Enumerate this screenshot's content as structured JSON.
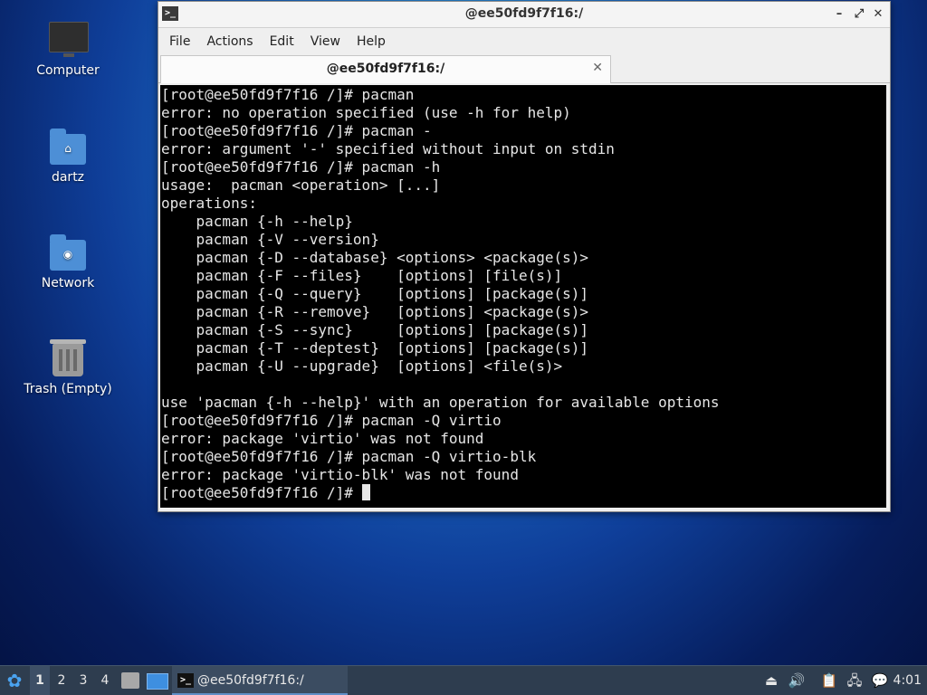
{
  "desktop": {
    "icons": [
      {
        "label": "Computer"
      },
      {
        "label": "dartz"
      },
      {
        "label": "Network"
      },
      {
        "label": "Trash (Empty)"
      }
    ]
  },
  "window": {
    "title": "@ee50fd9f7f16:/",
    "controls": {
      "minimize": "–",
      "maximize": "⤢",
      "close": "✕"
    },
    "menu": [
      "File",
      "Actions",
      "Edit",
      "View",
      "Help"
    ],
    "tab": {
      "label": "@ee50fd9f7f16:/",
      "close": "✕"
    },
    "terminal_lines": [
      "[root@ee50fd9f7f16 /]# pacman",
      "error: no operation specified (use -h for help)",
      "[root@ee50fd9f7f16 /]# pacman -",
      "error: argument '-' specified without input on stdin",
      "[root@ee50fd9f7f16 /]# pacman -h",
      "usage:  pacman <operation> [...]",
      "operations:",
      "    pacman {-h --help}",
      "    pacman {-V --version}",
      "    pacman {-D --database} <options> <package(s)>",
      "    pacman {-F --files}    [options] [file(s)]",
      "    pacman {-Q --query}    [options] [package(s)]",
      "    pacman {-R --remove}   [options] <package(s)>",
      "    pacman {-S --sync}     [options] [package(s)]",
      "    pacman {-T --deptest}  [options] [package(s)]",
      "    pacman {-U --upgrade}  [options] <file(s)>",
      "",
      "use 'pacman {-h --help}' with an operation for available options",
      "[root@ee50fd9f7f16 /]# pacman -Q virtio",
      "error: package 'virtio' was not found",
      "[root@ee50fd9f7f16 /]# pacman -Q virtio-blk",
      "error: package 'virtio-blk' was not found"
    ],
    "prompt": "[root@ee50fd9f7f16 /]# "
  },
  "taskbar": {
    "workspaces": [
      "1",
      "2",
      "3",
      "4"
    ],
    "active_workspace": "1",
    "task_label": "@ee50fd9f7f16:/",
    "clock": "4:01"
  }
}
